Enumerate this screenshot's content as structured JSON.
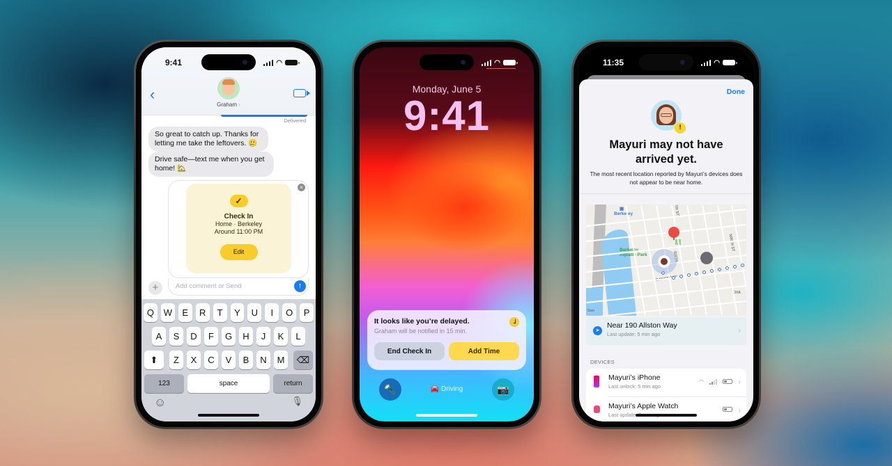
{
  "colors": {
    "ios_blue": "#1a7cf4",
    "checkin_yellow": "#f8cd2a",
    "checkin_card_bg": "#fbf3d6",
    "notif_yellow": "#fed84f",
    "alert_red": "#ee4a44"
  },
  "messages_phone": {
    "status": {
      "time": "9:41"
    },
    "header": {
      "back_icon": "chevron-left-icon",
      "contact_name": "Graham",
      "video_icon": "facetime-video-icon"
    },
    "delivered_label": "Delivered",
    "bubbles": [
      {
        "text": "So great to catch up. Thanks for letting me take the leftovers. 🥲"
      },
      {
        "text": "Drive safe—text me when you get home! 🏡"
      }
    ],
    "checkin": {
      "check_icon": "✓",
      "title": "Check In",
      "destination": "Home · Berkeley",
      "eta": "Around 11:00 PM",
      "edit_label": "Edit",
      "close_icon": "×"
    },
    "compose": {
      "plus_icon": "+",
      "placeholder": "Add comment or Send",
      "send_icon": "↑"
    },
    "keyboard": {
      "row1": [
        "Q",
        "W",
        "E",
        "R",
        "T",
        "Y",
        "U",
        "I",
        "O",
        "P"
      ],
      "row2": [
        "A",
        "S",
        "D",
        "F",
        "G",
        "H",
        "J",
        "K",
        "L"
      ],
      "row3": [
        "Z",
        "X",
        "C",
        "V",
        "B",
        "N",
        "M"
      ],
      "shift_icon": "⬆",
      "delete_icon": "⌫",
      "numbers_label": "123",
      "space_label": "space",
      "return_label": "return",
      "emoji_icon": "☺",
      "mic_icon": "🎙"
    }
  },
  "lock_phone": {
    "date": "Monday, June 5",
    "time": "9:41",
    "notification": {
      "title": "It looks like you’re delayed.",
      "subtitle": "Graham will be notified in 15 min.",
      "end_label": "End Check In",
      "add_time_label": "Add Time"
    },
    "flashlight_icon": "🔦",
    "driving_label": "🚘 Driving",
    "camera_icon": "📷"
  },
  "findmy_phone": {
    "status": {
      "time": "11:35"
    },
    "done_label": "Done",
    "warn_icon": "!",
    "title": "Mayuri may not have arrived yet.",
    "description": "The most recent location reported by Mayuri’s devices does not appear to be near home.",
    "map": {
      "label_berkeley": "Berkeley",
      "label_park": "Berkeley Aquatic Park",
      "label_7th": "7TH ST",
      "label_ninth": "NINTH ST",
      "label_bancroft": "BANCROFT",
      "label_sixth": "SIXTH",
      "label_san": "San",
      "label_cha": "CHA"
    },
    "location": {
      "title": "Near 190 Allston Way",
      "subtitle": "Last update: 5 min ago",
      "icon": "➤"
    },
    "devices_label": "DEVICES",
    "devices": [
      {
        "name": "Mayuri’s iPhone",
        "sub": "Last unlock: 5 min ago"
      },
      {
        "name": "Mayuri’s Apple Watch",
        "sub": "Last update: 5 min ago"
      }
    ]
  }
}
